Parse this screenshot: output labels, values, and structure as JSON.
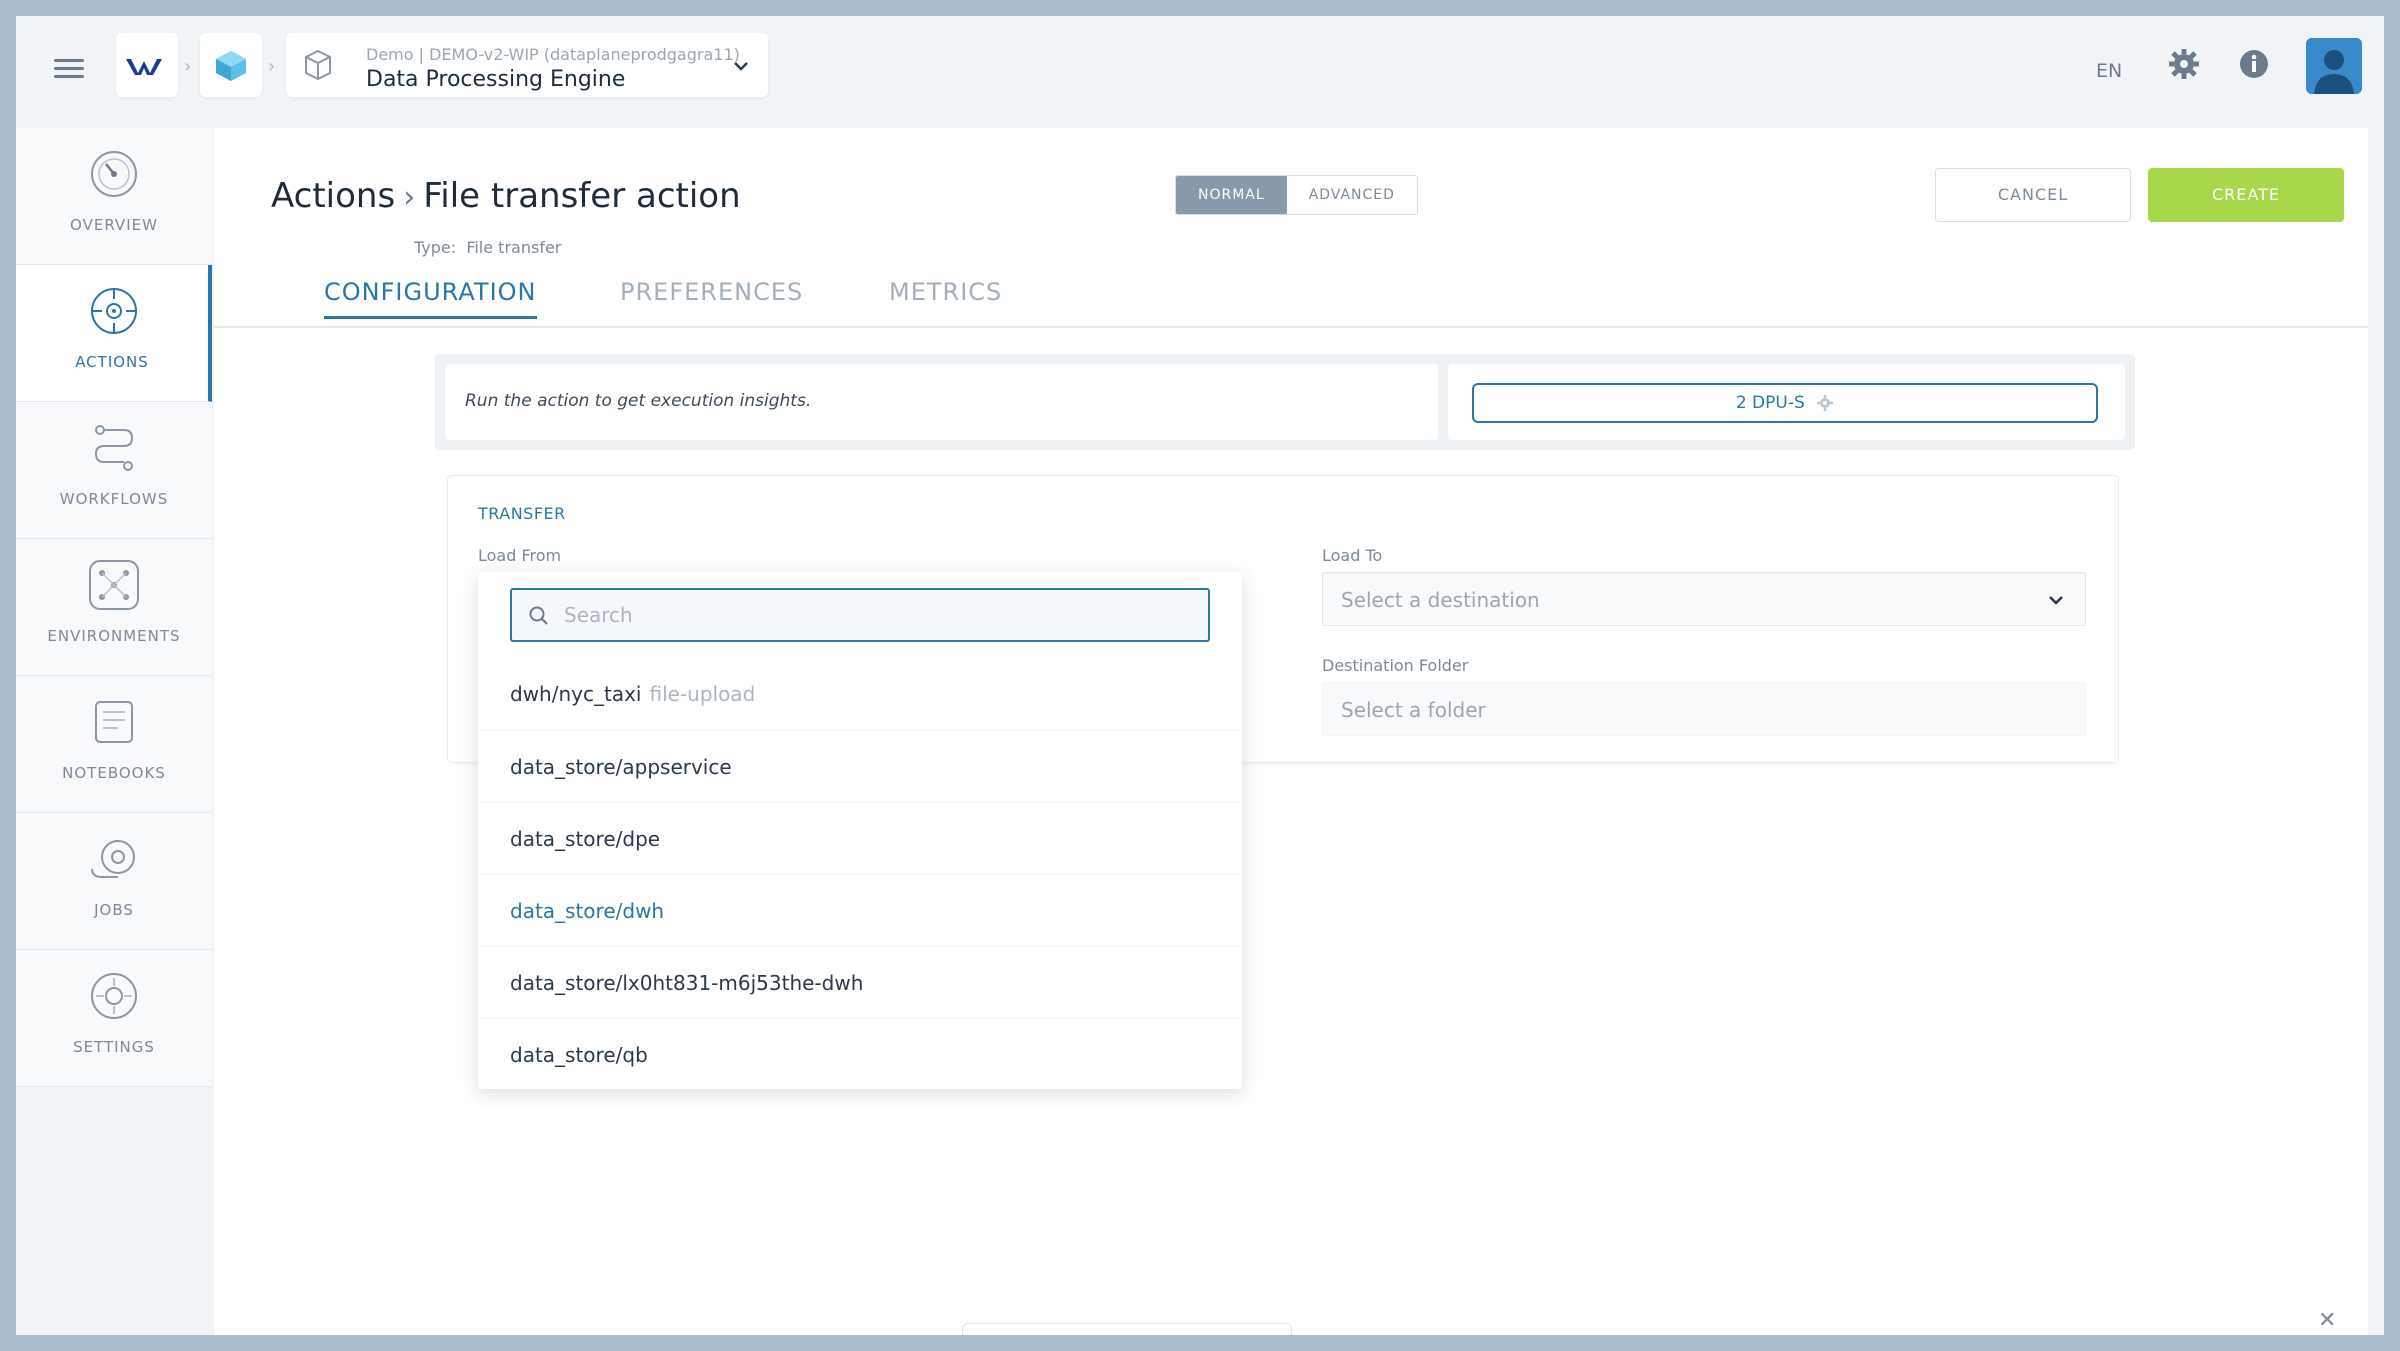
{
  "header": {
    "project_sub": "Demo | DEMO-v2-WIP (dataplaneprodgagra11)",
    "project_title": "Data Processing Engine",
    "language": "EN",
    "icons": [
      "menu-icon",
      "logo-icon",
      "cube-icon",
      "package-icon",
      "chevron-down-icon",
      "gear-icon",
      "info-icon",
      "avatar-icon"
    ]
  },
  "sidebar": {
    "items": [
      {
        "label": "OVERVIEW",
        "icon": "gauge-icon"
      },
      {
        "label": "ACTIONS",
        "icon": "target-icon"
      },
      {
        "label": "WORKFLOWS",
        "icon": "workflow-icon"
      },
      {
        "label": "ENVIRONMENTS",
        "icon": "network-icon"
      },
      {
        "label": "NOTEBOOKS",
        "icon": "notebook-icon"
      },
      {
        "label": "JOBS",
        "icon": "jobs-icon"
      },
      {
        "label": "SETTINGS",
        "icon": "settings-icon"
      }
    ]
  },
  "page": {
    "breadcrumb_root": "Actions",
    "breadcrumb_current": "File transfer action",
    "type_label": "Type:",
    "type_value": "File transfer",
    "mode_normal": "NORMAL",
    "mode_advanced": "ADVANCED",
    "cancel_label": "CANCEL",
    "create_label": "CREATE"
  },
  "tabs": [
    {
      "label": "CONFIGURATION"
    },
    {
      "label": "PREFERENCES"
    },
    {
      "label": "METRICS"
    }
  ],
  "insights": {
    "message": "Run the action to get execution insights.",
    "dpu_label": "2 DPU-S"
  },
  "transfer": {
    "section_title": "TRANSFER",
    "load_from_label": "Load From",
    "load_to_label": "Load To",
    "load_to_placeholder": "Select a destination",
    "dest_folder_label": "Destination Folder",
    "dest_folder_placeholder": "Select a folder"
  },
  "dropdown": {
    "search_placeholder": "Search",
    "items": [
      {
        "name": "dwh/nyc_taxi",
        "tag": "file-upload"
      },
      {
        "name": "data_store/appservice",
        "tag": ""
      },
      {
        "name": "data_store/dpe",
        "tag": ""
      },
      {
        "name": "data_store/dwh",
        "tag": ""
      },
      {
        "name": "data_store/lx0ht831-m6j53the-dwh",
        "tag": ""
      },
      {
        "name": "data_store/qb",
        "tag": ""
      }
    ],
    "highlighted_item": "data_store/dwh"
  },
  "colors": {
    "accent": "#2b76a8",
    "create": "#a7d84b",
    "frame": "#a9bfcf"
  }
}
